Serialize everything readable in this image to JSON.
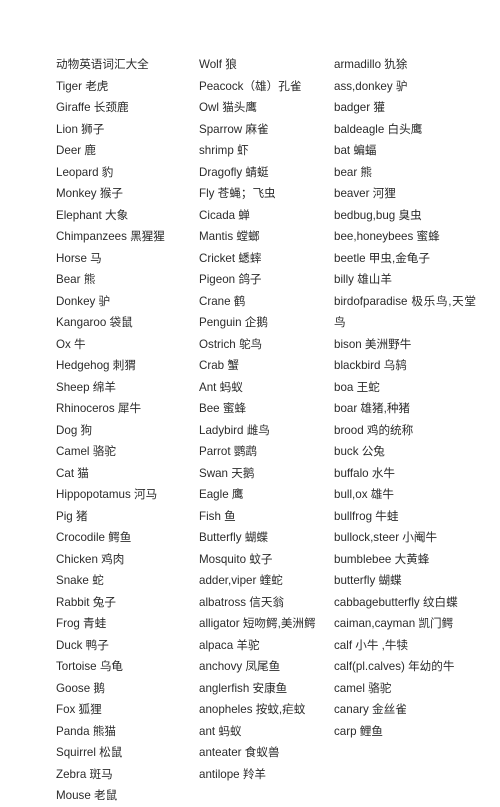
{
  "document": {
    "title": "动物英语词汇大全",
    "background_color": "#ffffff",
    "text_color": "#2b2b2b"
  },
  "columns": [
    {
      "name": "column-left",
      "entries": [
        "动物英语词汇大全",
        "Tiger 老虎",
        "Giraffe 长颈鹿",
        "Lion 狮子",
        "Deer 鹿",
        "Leopard 豹",
        "Monkey 猴子",
        "Elephant 大象",
        "Chimpanzees 黑猩猩",
        "Horse 马",
        "Bear 熊",
        "Donkey 驴",
        "Kangaroo 袋鼠",
        "Ox 牛",
        "Hedgehog 刺猬",
        "Sheep 绵羊",
        "Rhinoceros 犀牛",
        "Dog 狗",
        "Camel 骆驼",
        "Cat 猫",
        "Hippopotamus 河马",
        "Pig 猪",
        "Crocodile 鳄鱼",
        "Chicken 鸡肉",
        "Snake 蛇",
        "Rabbit 兔子",
        "Frog 青蛙",
        "Duck 鸭子",
        "Tortoise 乌龟",
        "Goose 鹅",
        "Fox 狐狸",
        "Panda 熊猫",
        "Squirrel 松鼠",
        "Zebra 斑马",
        "Mouse 老鼠"
      ]
    },
    {
      "name": "column-middle",
      "entries": [
        "Wolf 狼",
        "Peacock（雄）孔雀",
        "Owl 猫头鹰",
        "Sparrow 麻雀",
        "shrimp 虾",
        "Dragofly 蜻蜓",
        "Fly 苍蝇；飞虫",
        "Cicada 蝉",
        "Mantis 螳螂",
        "Cricket 蟋蟀",
        "Pigeon 鸽子",
        "Crane 鹤",
        "Penguin 企鹅",
        "Ostrich 鸵鸟",
        "Crab 蟹",
        "Ant 蚂蚁",
        "Bee 蜜蜂",
        "Ladybird 雌鸟",
        "Parrot 鹦鹉",
        "Swan 天鹅",
        "Eagle 鹰",
        "Fish 鱼",
        "Butterfly 蝴蝶",
        "Mosquito 蚊子",
        "adder,viper 蝰蛇",
        "albatross 信天翁",
        "alligator 短吻鳄,美洲鳄",
        "alpaca 羊驼",
        "anchovy 凤尾鱼",
        "anglerfish 安康鱼",
        "anopheles 按蚊,疟蚊",
        "ant 蚂蚁",
        "anteater 食蚁兽",
        "antilope 羚羊"
      ]
    },
    {
      "name": "column-right",
      "entries": [
        "armadillo 犰狳",
        "ass,donkey 驴",
        "badger 獾",
        "baldeagle 白头鹰",
        "bat 蝙蝠",
        "bear 熊",
        "beaver 河狸",
        "bedbug,bug 臭虫",
        "bee,honeybees 蜜蜂",
        "beetle 甲虫,金龟子",
        "billy 雄山羊",
        "birdofparadise 极乐鸟,天堂鸟",
        "bison 美洲野牛",
        "blackbird 乌鸫",
        "boa 王蛇",
        "boar 雄猪,种猪",
        "brood 鸡的统称",
        "buck 公兔",
        "buffalo 水牛",
        "bull,ox 雄牛",
        "bullfrog 牛蛙",
        "bullock,steer 小阉牛",
        "bumblebee 大黄蜂",
        "butterfly 蝴蝶",
        "cabbagebutterfly 纹白蝶",
        "caiman,cayman 凯门鳄",
        "calf 小牛 ,牛犊",
        "calf(pl.calves) 年幼的牛",
        "camel 骆驼",
        "canary 金丝雀",
        "carp 鲤鱼"
      ]
    }
  ]
}
